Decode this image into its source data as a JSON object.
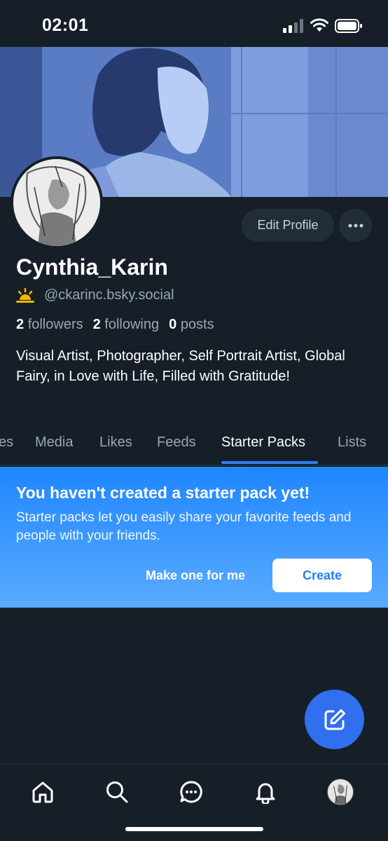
{
  "status_bar": {
    "time": "02:01"
  },
  "profile": {
    "display_name": "Cynthia_Karin",
    "handle": "@ckarinc.bsky.social",
    "edit_button": "Edit Profile",
    "followers_count": "2",
    "followers_label": "followers",
    "following_count": "2",
    "following_label": "following",
    "posts_count": "0",
    "posts_label": "posts",
    "bio": "Visual Artist, Photographer, Self Portrait Artist, Global Fairy, in Love with Life, Filled with Gratitude!"
  },
  "tabs": [
    {
      "label": "es"
    },
    {
      "label": "Media"
    },
    {
      "label": "Likes"
    },
    {
      "label": "Feeds"
    },
    {
      "label": "Starter Packs",
      "active": true
    },
    {
      "label": "Lists"
    }
  ],
  "starter_pack": {
    "title": "You haven't created a starter pack yet!",
    "description": "Starter packs let you easily share your favorite feeds and people with your friends.",
    "make_one_label": "Make one for me",
    "create_label": "Create"
  },
  "colors": {
    "background": "#161e27",
    "accent": "#2f7ff0",
    "card_gradient_top": "#1f86ff",
    "card_gradient_bottom": "#5aabff",
    "muted_text": "#9aa7b6"
  },
  "icons": {
    "signal": "cellular-signal-icon",
    "wifi": "wifi-icon",
    "battery": "battery-icon",
    "handle_emoji": "sun-icon",
    "more": "ellipsis-icon",
    "compose": "compose-icon",
    "nav": [
      "home-icon",
      "search-icon",
      "chat-icon",
      "bell-icon",
      "profile-avatar"
    ]
  }
}
